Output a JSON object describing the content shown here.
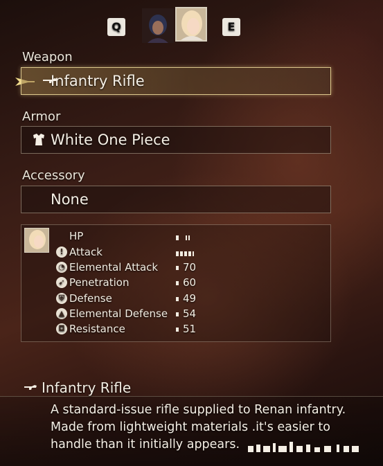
{
  "switcher": {
    "prev_key": "Q",
    "next_key": "E"
  },
  "weapon": {
    "label": "Weapon",
    "item": "Infantry Rifle"
  },
  "armor": {
    "label": "Armor",
    "item": "White One Piece"
  },
  "accessory": {
    "label": "Accessory",
    "item": "None"
  },
  "stats": [
    {
      "name": "HP",
      "value": "",
      "icon": "none"
    },
    {
      "name": "Attack",
      "value": "",
      "icon": "attack-icon"
    },
    {
      "name": "Elemental Attack",
      "value": "70",
      "icon": "elemental-attack-icon"
    },
    {
      "name": "Penetration",
      "value": "60",
      "icon": "penetration-icon"
    },
    {
      "name": "Defense",
      "value": "49",
      "icon": "defense-icon"
    },
    {
      "name": "Elemental Defense",
      "value": "54",
      "icon": "elemental-defense-icon"
    },
    {
      "name": "Resistance",
      "value": "51",
      "icon": "resistance-icon"
    }
  ],
  "description": {
    "title": "Infantry Rifle",
    "lines": [
      "A standard-issue rifle supplied to Renan infantry.",
      "Made from lightweight materials .it's easier to",
      "handle than it initially appears."
    ]
  },
  "colors": {
    "selected_border": "#f5e1a0",
    "text": "#f2ece2",
    "cursor": "#f0dc8c"
  }
}
